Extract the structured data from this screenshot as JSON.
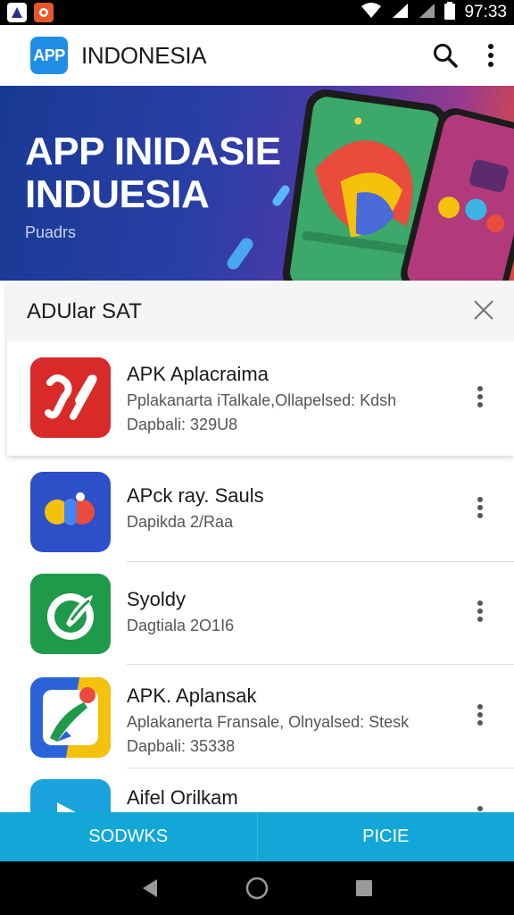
{
  "status_bar": {
    "time": "97:33"
  },
  "app_bar": {
    "logo_text": "APP",
    "title": "INDONESIA"
  },
  "banner": {
    "title_line1": "APP INIDASIE",
    "title_line2": "INDUESIA",
    "caption": "Puadrs"
  },
  "ad": {
    "header_title": "ADUlar SAT",
    "item": {
      "title": "APK Aplacraima",
      "line1": "Pplakanarta iTalkale,Ollapelsed: Kdsh",
      "line2": "Dapbali: 329U8"
    }
  },
  "apps": [
    {
      "title": "APck ray. Sauls",
      "line1": "Dapikda 2/Raa",
      "line2": ""
    },
    {
      "title": "Syoldy",
      "line1": "Dagtiala 2O1I6",
      "line2": ""
    },
    {
      "title": "APK. Aplansak",
      "line1": "Aplakanerta Fransale, Olnyalsed: Stesk",
      "line2": "Dapbali: 35338"
    },
    {
      "title": "Aifel Orilkam",
      "line1": "",
      "line2": ""
    }
  ],
  "tabs": [
    {
      "label": "SODWKS"
    },
    {
      "label": "PICIE"
    }
  ],
  "colors": {
    "accent": "#12a7d6",
    "logo": "#1f8ee6",
    "banner_start": "#183a93",
    "banner_end": "#e04a3a"
  },
  "icons": [
    "search-icon",
    "more-vert-icon",
    "close-icon",
    "back-icon",
    "home-icon",
    "recents-icon"
  ]
}
